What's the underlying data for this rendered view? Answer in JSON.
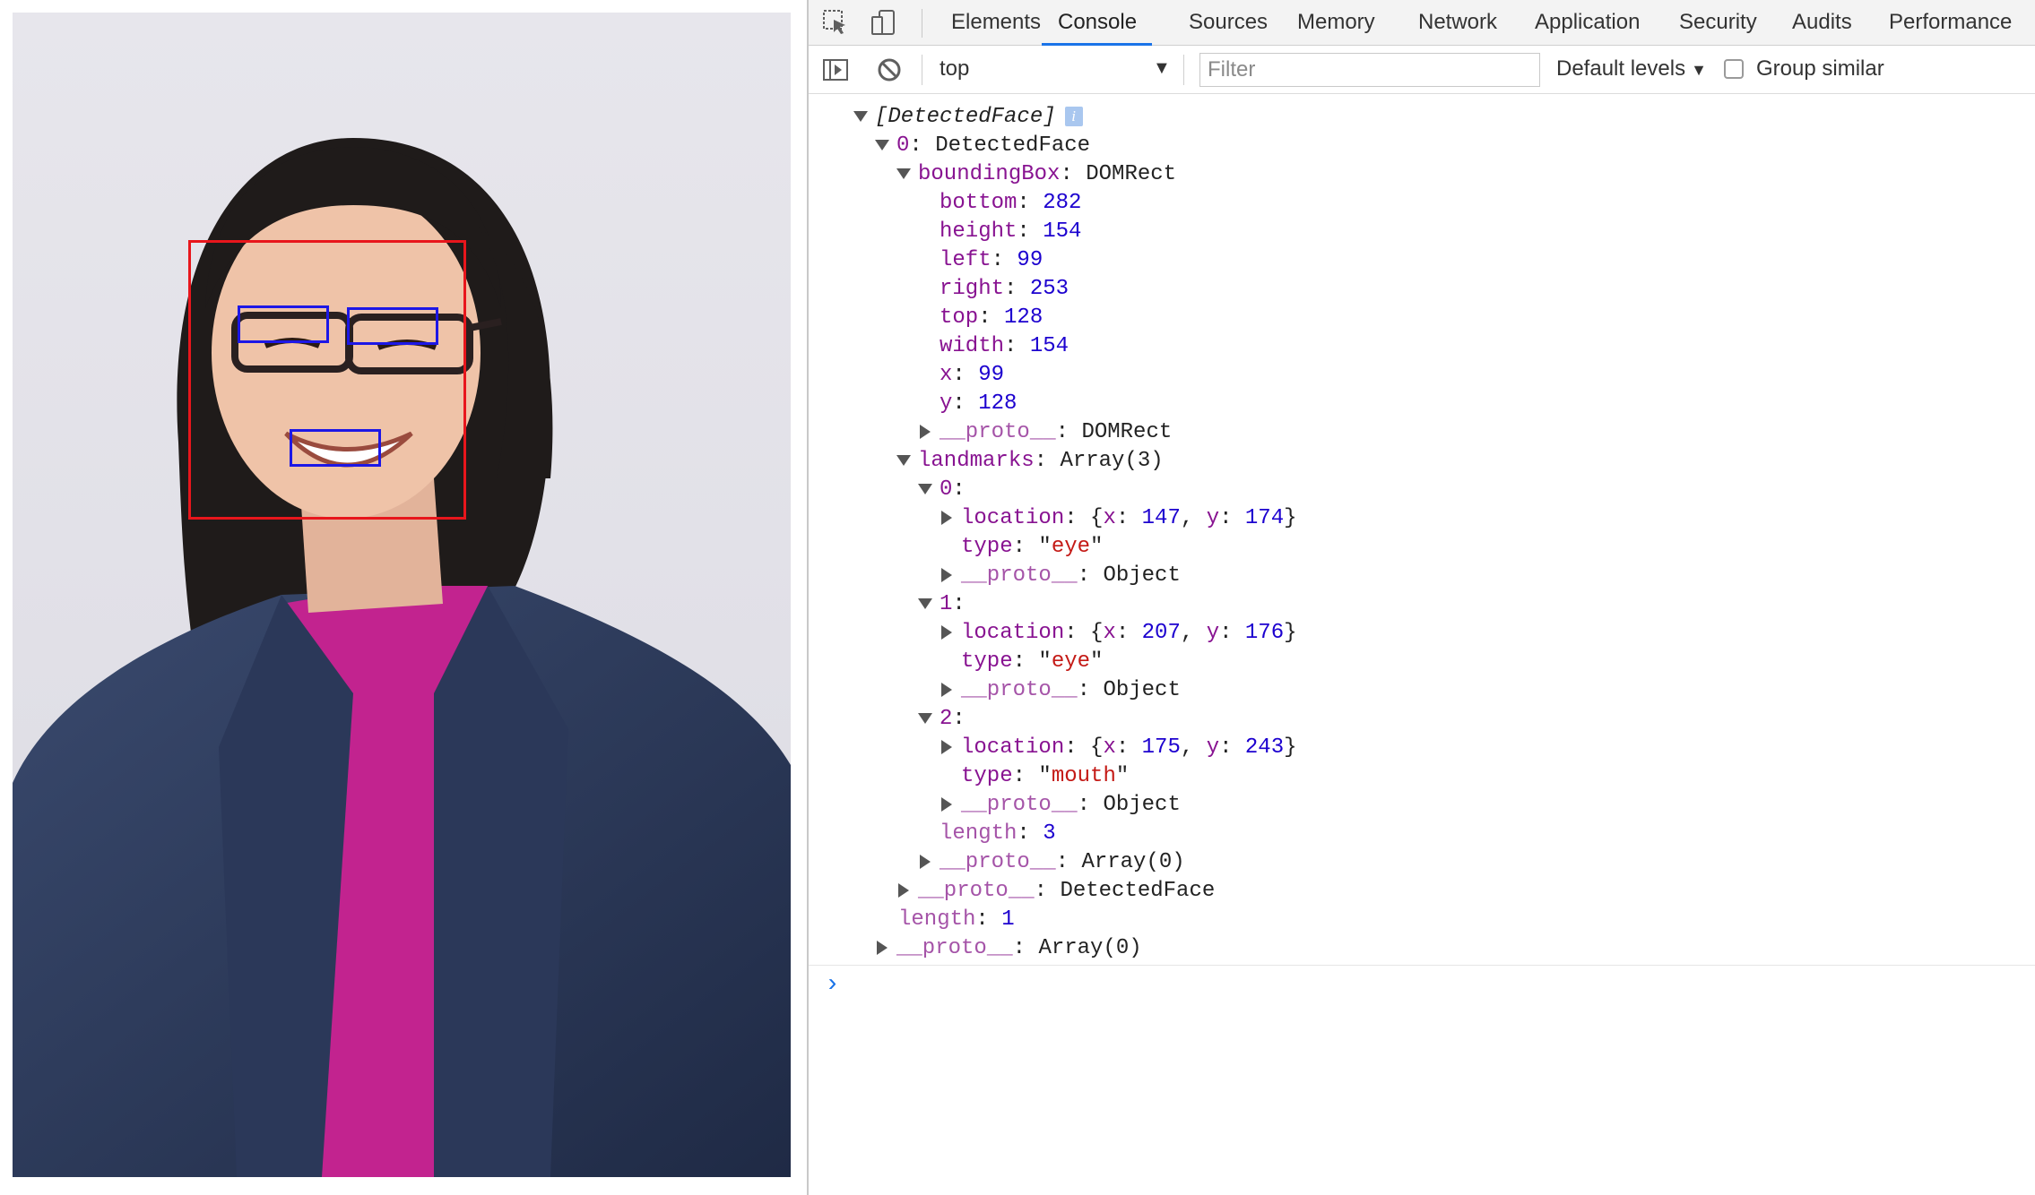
{
  "colors": {
    "face_box": "#e8161c",
    "landmark_box": "#1d17e6",
    "active_tab": "#1a73e8",
    "key": "#881391",
    "number": "#1c00cf",
    "string": "#c41a16"
  },
  "tabs": [
    "Elements",
    "Console",
    "Sources",
    "Memory",
    "Network",
    "Application",
    "Security",
    "Audits",
    "Performance"
  ],
  "active_tab": "Console",
  "toolbar": {
    "context": "top",
    "filter_placeholder": "Filter",
    "levels": "Default levels",
    "group_similar": "Group similar"
  },
  "console": {
    "root_label": "[DetectedFace]",
    "info_glyph": "i",
    "item0_key": "0",
    "item0_type": "DetectedFace",
    "bb_key": "boundingBox",
    "bb_type": "DOMRect",
    "bottom": "282",
    "height": "154",
    "left": "99",
    "right": "253",
    "top": "128",
    "width": "154",
    "x": "99",
    "y": "128",
    "proto_key": "__proto__",
    "domrect": "DOMRect",
    "landmarks_key": "landmarks",
    "landmarks_type": "Array(3)",
    "lm0_key": "0",
    "lm0_x": "147",
    "lm0_y": "174",
    "lm0_type": "eye",
    "lm1_key": "1",
    "lm1_x": "207",
    "lm1_y": "176",
    "lm1_type": "eye",
    "lm2_key": "2",
    "lm2_x": "175",
    "lm2_y": "243",
    "lm2_type": "mouth",
    "object": "Object",
    "location_key": "location",
    "type_key": "type",
    "length_key": "length",
    "lm_length": "3",
    "array0": "Array(0)",
    "detected_face": "DetectedFace",
    "root_length": "1"
  },
  "prompt_glyph": "›"
}
